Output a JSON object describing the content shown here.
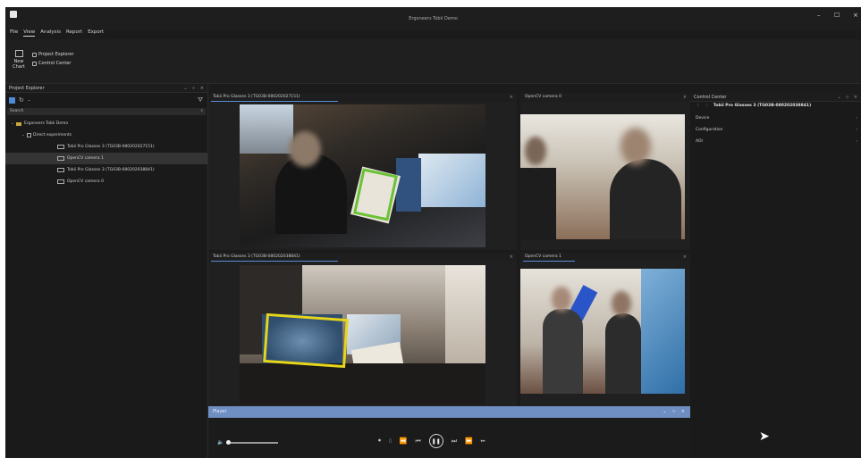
{
  "window": {
    "title": "Ergoneers Tobii Demo",
    "minimize": "–",
    "maximize": "☐",
    "close": "×"
  },
  "menu": [
    "File",
    "View",
    "Analysis",
    "Report",
    "Export"
  ],
  "ribbon": {
    "new_chart_label": "New Chart",
    "checks": [
      "Project Explorer",
      "Control Center"
    ]
  },
  "project_explorer": {
    "title": "Project Explorer",
    "search_placeholder": "Search",
    "tree": [
      {
        "label": "Ergoneers Tobii Demo",
        "level": 0,
        "type": "folder"
      },
      {
        "label": "Direct experiments",
        "level": 1,
        "type": "check"
      },
      {
        "label": "Tobii Pro Glasses 3 (TG03B-080202027151)",
        "level": 2,
        "type": "camera"
      },
      {
        "label": "OpenCV camera 1",
        "level": 2,
        "type": "camera",
        "selected": true
      },
      {
        "label": "Tobii Pro Glasses 3 (TG03B-080202038841)",
        "level": 2,
        "type": "camera"
      },
      {
        "label": "OpenCV camera 0",
        "level": 2,
        "type": "camera"
      }
    ]
  },
  "tiles": {
    "top_left": "Tobii Pro Glasses 3 (TG03B-080202027151)",
    "top_right": "OpenCV camera 0",
    "bottom_left": "Tobii Pro Glasses 3 (TG03B-080202038841)",
    "bottom_right": "OpenCV camera 1"
  },
  "control_center": {
    "title": "Control Center",
    "device_title": "Tobii Pro Glasses 3 (TG03B-080202038841)",
    "sections": [
      "Device",
      "Configuration",
      "AOI"
    ]
  },
  "player": {
    "title": "Player",
    "volume": 0.0
  },
  "colors": {
    "accent": "#5b8fd8",
    "gaze_green": "#6bc235",
    "gaze_yellow": "#e6d51a",
    "player_bar": "#6f8fc2"
  }
}
